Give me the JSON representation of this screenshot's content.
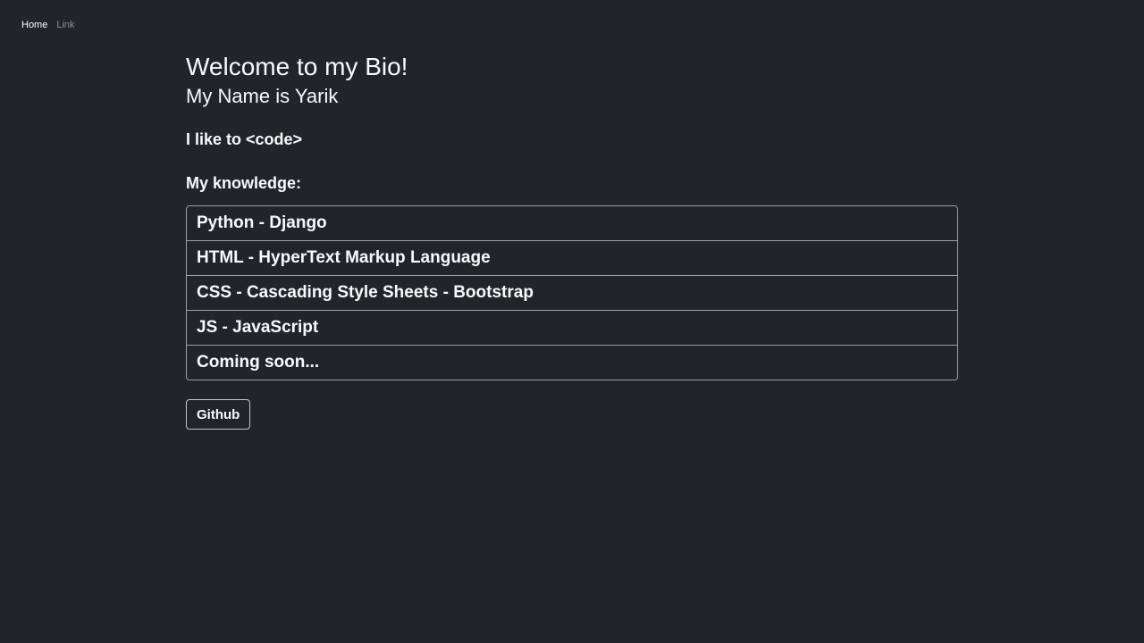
{
  "nav": {
    "items": [
      {
        "label": "Home"
      },
      {
        "label": "Link"
      }
    ]
  },
  "main": {
    "title": "Welcome to my Bio!",
    "subtitle": "My Name is Yarik",
    "likes": "I like to <code>",
    "knowledge_heading": "My knowledge:",
    "knowledge": [
      "Python - Django",
      "HTML - HyperText Markup Language",
      "CSS - Cascading Style Sheets - Bootstrap",
      "JS - JavaScript",
      "Coming soon..."
    ],
    "github_label": "Github"
  },
  "colors": {
    "background": "#212529",
    "text": "#f8f9fa",
    "muted_link": "#8a8f95",
    "border": "#9aa0a6"
  }
}
